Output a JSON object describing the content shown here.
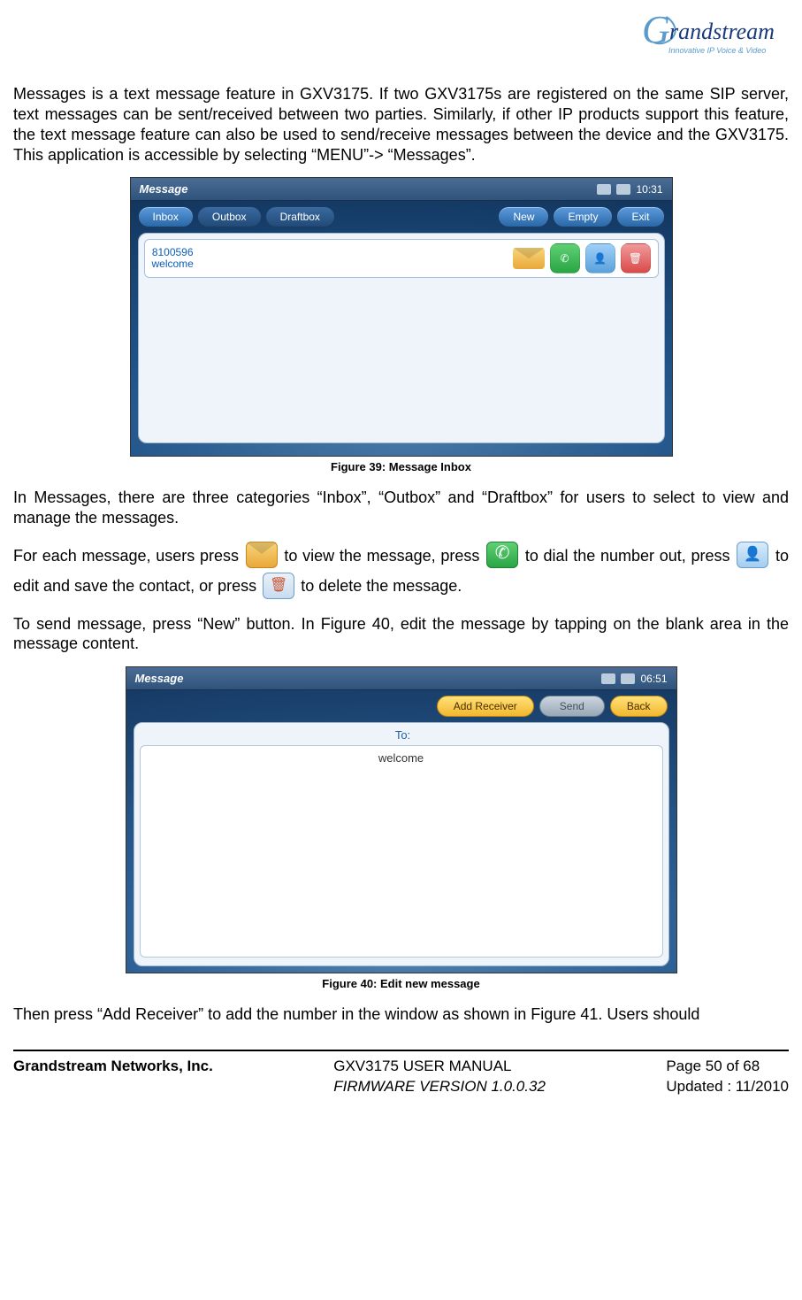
{
  "logo": {
    "big_g": "G",
    "name": "randstream",
    "tagline": "Innovative IP Voice & Video"
  },
  "p1": "Messages is a text message feature in GXV3175. If two GXV3175s are registered on the same SIP server, text messages can be sent/received between two parties. Similarly, if other IP products support this feature, the text message feature can also be used to send/receive messages between the device and the GXV3175. This application is accessible by selecting “MENU”-> “Messages”.",
  "fig39": {
    "title": "Message",
    "time": "10:31",
    "tabs": {
      "inbox": "Inbox",
      "outbox": "Outbox",
      "draftbox": "Draftbox"
    },
    "actions": {
      "new": "New",
      "empty": "Empty",
      "exit": "Exit"
    },
    "row": {
      "number": "8100596",
      "preview": "welcome"
    },
    "caption": "Figure 39: Message Inbox"
  },
  "p2": "In Messages, there are three categories “Inbox”, “Outbox” and “Draftbox” for users to select to view and manage the messages.",
  "p3": {
    "a": "For each message, users press ",
    "b": " to view the message, press ",
    "c": " to dial the number out, press ",
    "d": " to edit and save the contact, or press ",
    "e": " to delete the message."
  },
  "p4": "To send message, press “New” button. In Figure 40, edit the message by tapping on the blank area in the message content.",
  "fig40": {
    "title": "Message",
    "time": "06:51",
    "actions": {
      "add_receiver": "Add Receiver",
      "send": "Send",
      "back": "Back"
    },
    "to_label": "To:",
    "body": "welcome",
    "caption": "Figure 40: Edit new message"
  },
  "p5": "Then press “Add Receiver” to add the number in the window as shown in Figure 41. Users should",
  "footer": {
    "company": "Grandstream Networks, Inc.",
    "manual": "GXV3175 USER MANUAL",
    "firmware": "FIRMWARE VERSION 1.0.0.32",
    "page": "Page 50 of 68",
    "updated": "Updated : 11/2010"
  }
}
